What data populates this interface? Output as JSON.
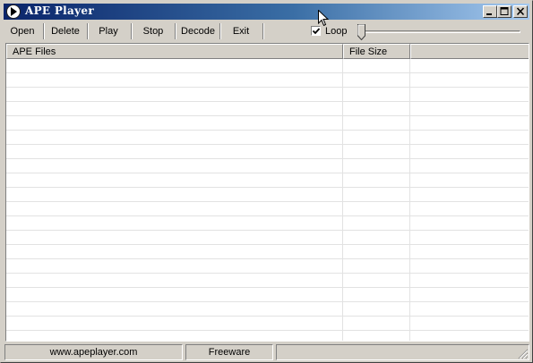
{
  "window": {
    "title": "APE Player",
    "controls": [
      "minimize-icon",
      "maximize-icon",
      "close-icon"
    ]
  },
  "toolbar": {
    "open_label": "Open",
    "delete_label": "Delete",
    "play_label": "Play",
    "stop_label": "Stop",
    "decode_label": "Decode",
    "exit_label": "Exit",
    "loop_label": "Loop",
    "loop_checked": true,
    "position_slider": 0
  },
  "file_list": {
    "columns": [
      "APE Files",
      "File Size",
      ""
    ],
    "rows": []
  },
  "statusbar": {
    "website": "www.apeplayer.com",
    "license": "Freeware",
    "extra": ""
  },
  "colors": {
    "titlebar_start": "#0a246a",
    "titlebar_end": "#a6caf0",
    "face": "#d4d0c8",
    "list_background": "#ffffff"
  }
}
